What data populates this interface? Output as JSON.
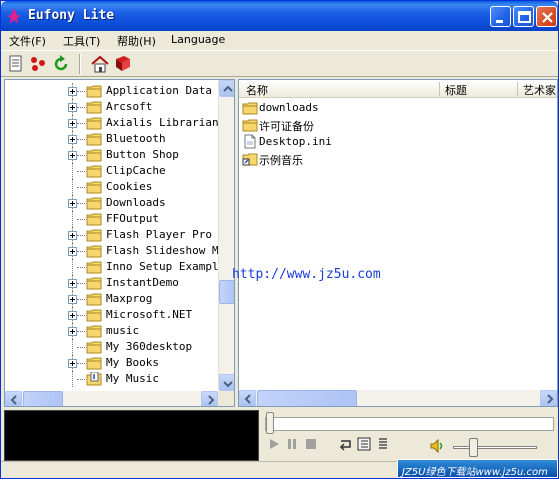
{
  "window": {
    "title": "Eufony Lite"
  },
  "menu": {
    "items": [
      "文件(F)",
      "工具(T)",
      "帮助(H)",
      "Language"
    ]
  },
  "toolbar": {
    "icons": [
      "new-playlist-icon",
      "shuffle-icon",
      "refresh-icon",
      "home-icon",
      "book-icon"
    ]
  },
  "tree": {
    "items": [
      {
        "label": "Application Data",
        "expandable": true
      },
      {
        "label": "Arcsoft",
        "expandable": true
      },
      {
        "label": "Axialis Librarian",
        "expandable": true
      },
      {
        "label": "Bluetooth",
        "expandable": true
      },
      {
        "label": "Button Shop",
        "expandable": true
      },
      {
        "label": "ClipCache",
        "expandable": false
      },
      {
        "label": "Cookies",
        "expandable": false
      },
      {
        "label": "Downloads",
        "expandable": true
      },
      {
        "label": "FFOutput",
        "expandable": false
      },
      {
        "label": "Flash Player Pro",
        "expandable": true
      },
      {
        "label": "Flash Slideshow Mak",
        "expandable": true
      },
      {
        "label": "Inno Setup Examples",
        "expandable": false
      },
      {
        "label": "InstantDemo",
        "expandable": true
      },
      {
        "label": "Maxprog",
        "expandable": true
      },
      {
        "label": "Microsoft.NET",
        "expandable": true
      },
      {
        "label": "music",
        "expandable": true
      },
      {
        "label": "My 360desktop",
        "expandable": false
      },
      {
        "label": "My Books",
        "expandable": true
      },
      {
        "label": "My Music",
        "expandable": false,
        "special": true
      }
    ]
  },
  "list": {
    "columns": [
      "名称",
      "标题",
      "艺术家"
    ],
    "rows": [
      {
        "name": "downloads",
        "type": "folder"
      },
      {
        "name": "许可证备份",
        "type": "folder"
      },
      {
        "name": "Desktop.ini",
        "type": "file"
      },
      {
        "name": "示例音乐",
        "type": "shortcut-folder"
      }
    ]
  },
  "watermark": "http://www.jz5u.com",
  "player": {
    "seek_position": 0.0,
    "volume": 0.25
  },
  "badge": "JZ5U绿色下载站www.jz5u.com"
}
